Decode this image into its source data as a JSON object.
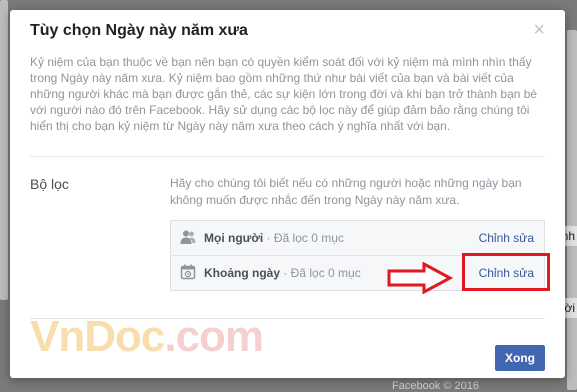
{
  "background": {
    "footer_text": "Facebook © 2016",
    "side_edit_label_1": "hỉnh",
    "side_edit_label_2": "ời"
  },
  "dialog": {
    "title": "Tùy chọn Ngày này năm xưa",
    "close_label": "×",
    "intro": "Kỷ niệm của bạn thuộc về bạn nên bạn có quyền kiểm soát đối với kỷ niệm mà mình nhìn thấy trong Ngày này năm xưa. Kỷ niệm bao gồm những thứ như bài viết của bạn và bài viết của những người khác mà bạn được gắn thẻ, các sự kiện lớn trong đời và khi bạn trở thành bạn bè với người nào đó trên Facebook. Hãy sử dụng các bộ lọc này để giúp đảm bảo rằng chúng tôi hiển thị cho bạn kỷ niệm từ Ngày này năm xưa theo cách ý nghĩa nhất với bạn.",
    "filters_label": "Bộ lọc",
    "filters_description": "Hãy cho chúng tôi biết nếu có những người hoặc những ngày bạn không muốn được nhắc đến trong Ngày này năm xưa.",
    "filters": [
      {
        "icon": "people-icon",
        "name": "Mọi người",
        "status": " · Đã lọc 0 mục",
        "edit_label": "Chỉnh sửa"
      },
      {
        "icon": "calendar-icon",
        "name": "Khoảng ngày",
        "status": " · Đã lọc 0 mục",
        "edit_label": "Chỉnh sửa"
      }
    ],
    "done_label": "Xong"
  },
  "watermark": {
    "part1": "VnDoc",
    "part2": ".com"
  },
  "colors": {
    "accent": "#4267b2",
    "link": "#365899",
    "highlight": "#e0191f"
  }
}
